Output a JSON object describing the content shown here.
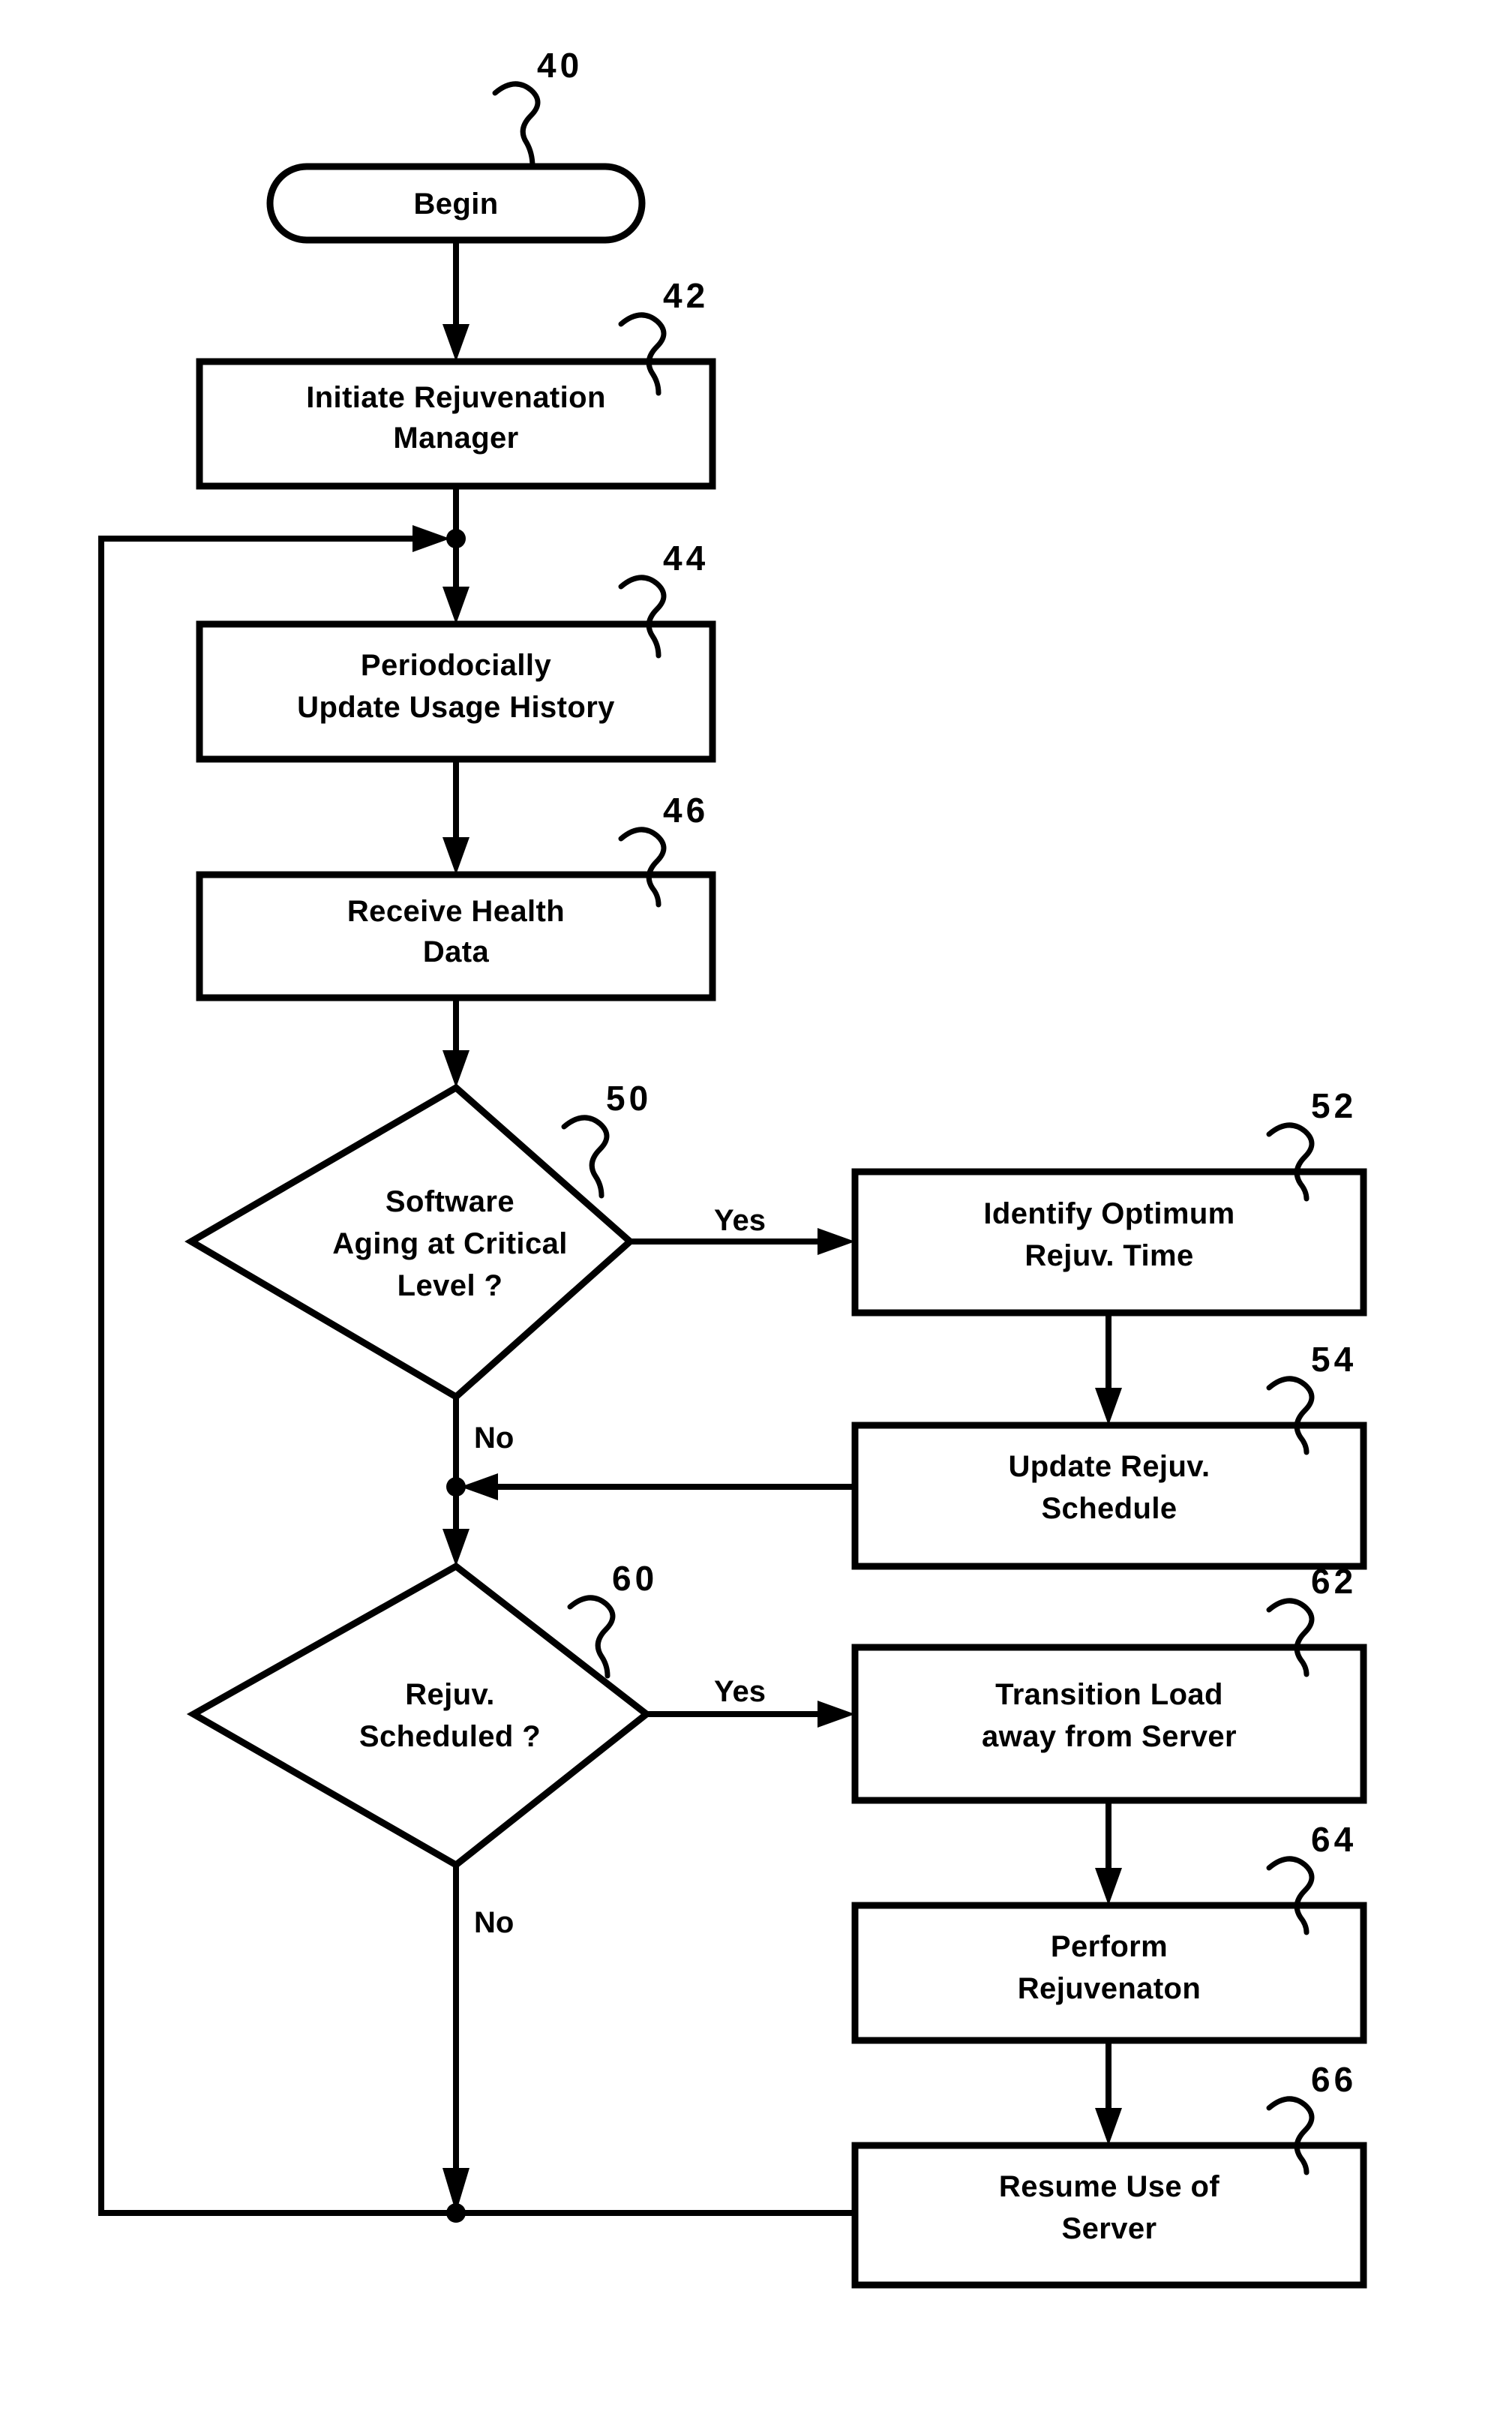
{
  "figure": {
    "type": "flowchart",
    "background_color": "#ffffff",
    "line_color": "#000000",
    "orientation": "vertical-with-right-branch"
  },
  "nodes": [
    {
      "id": "begin",
      "ref": "40",
      "shape": "terminator",
      "lines": [
        "Begin"
      ],
      "text": "Begin"
    },
    {
      "id": "initiate_manager",
      "ref": "42",
      "shape": "process",
      "lines": [
        "Initiate Rejuvenation",
        "Manager"
      ],
      "line1": "Initiate Rejuvenation",
      "line2": "Manager"
    },
    {
      "id": "update_usage_history",
      "ref": "44",
      "shape": "process",
      "lines": [
        "Periodocially",
        "Update Usage History"
      ],
      "line1": "Periodocially",
      "line2": "Update Usage History"
    },
    {
      "id": "receive_health_data",
      "ref": "46",
      "shape": "process",
      "lines": [
        "Receive Health",
        "Data"
      ],
      "line1": "Receive Health",
      "line2": "Data"
    },
    {
      "id": "software_aging_decision",
      "ref": "50",
      "shape": "decision",
      "lines": [
        "Software",
        "Aging at Critical",
        "Level ?"
      ],
      "line1": "Software",
      "line2": "Aging at Critical",
      "line3": "Level ?"
    },
    {
      "id": "identify_optimum_time",
      "ref": "52",
      "shape": "process",
      "lines": [
        "Identify Optimum",
        "Rejuv. Time"
      ],
      "line1": "Identify Optimum",
      "line2": "Rejuv. Time"
    },
    {
      "id": "update_rejuv_schedule",
      "ref": "54",
      "shape": "process",
      "lines": [
        "Update Rejuv.",
        "Schedule"
      ],
      "line1": "Update Rejuv.",
      "line2": "Schedule"
    },
    {
      "id": "rejuv_scheduled_decision",
      "ref": "60",
      "shape": "decision",
      "lines": [
        "Rejuv.",
        "Scheduled ?"
      ],
      "line1": "Rejuv.",
      "line2": "Scheduled ?"
    },
    {
      "id": "transition_load",
      "ref": "62",
      "shape": "process",
      "lines": [
        "Transition Load",
        "away from Server"
      ],
      "line1": "Transition Load",
      "line2": "away from Server"
    },
    {
      "id": "perform_rejuvenation",
      "ref": "64",
      "shape": "process",
      "lines": [
        "Perform",
        "Rejuvenaton"
      ],
      "line1": "Perform",
      "line2": "Rejuvenaton"
    },
    {
      "id": "resume_use_of_server",
      "ref": "66",
      "shape": "process",
      "lines": [
        "Resume Use of",
        "Server"
      ],
      "line1": "Resume Use of",
      "line2": "Server"
    }
  ],
  "branch_labels": {
    "aging_yes": "Yes",
    "aging_no": "No",
    "scheduled_yes": "Yes",
    "scheduled_no": "No"
  },
  "reference_numerals": {
    "begin": "40",
    "initiate_manager": "42",
    "update_usage_history": "44",
    "receive_health_data": "46",
    "software_aging_decision": "50",
    "identify_optimum_time": "52",
    "update_rejuv_schedule": "54",
    "rejuv_scheduled_decision": "60",
    "transition_load": "62",
    "perform_rejuvenation": "64",
    "resume_use_of_server": "66"
  }
}
